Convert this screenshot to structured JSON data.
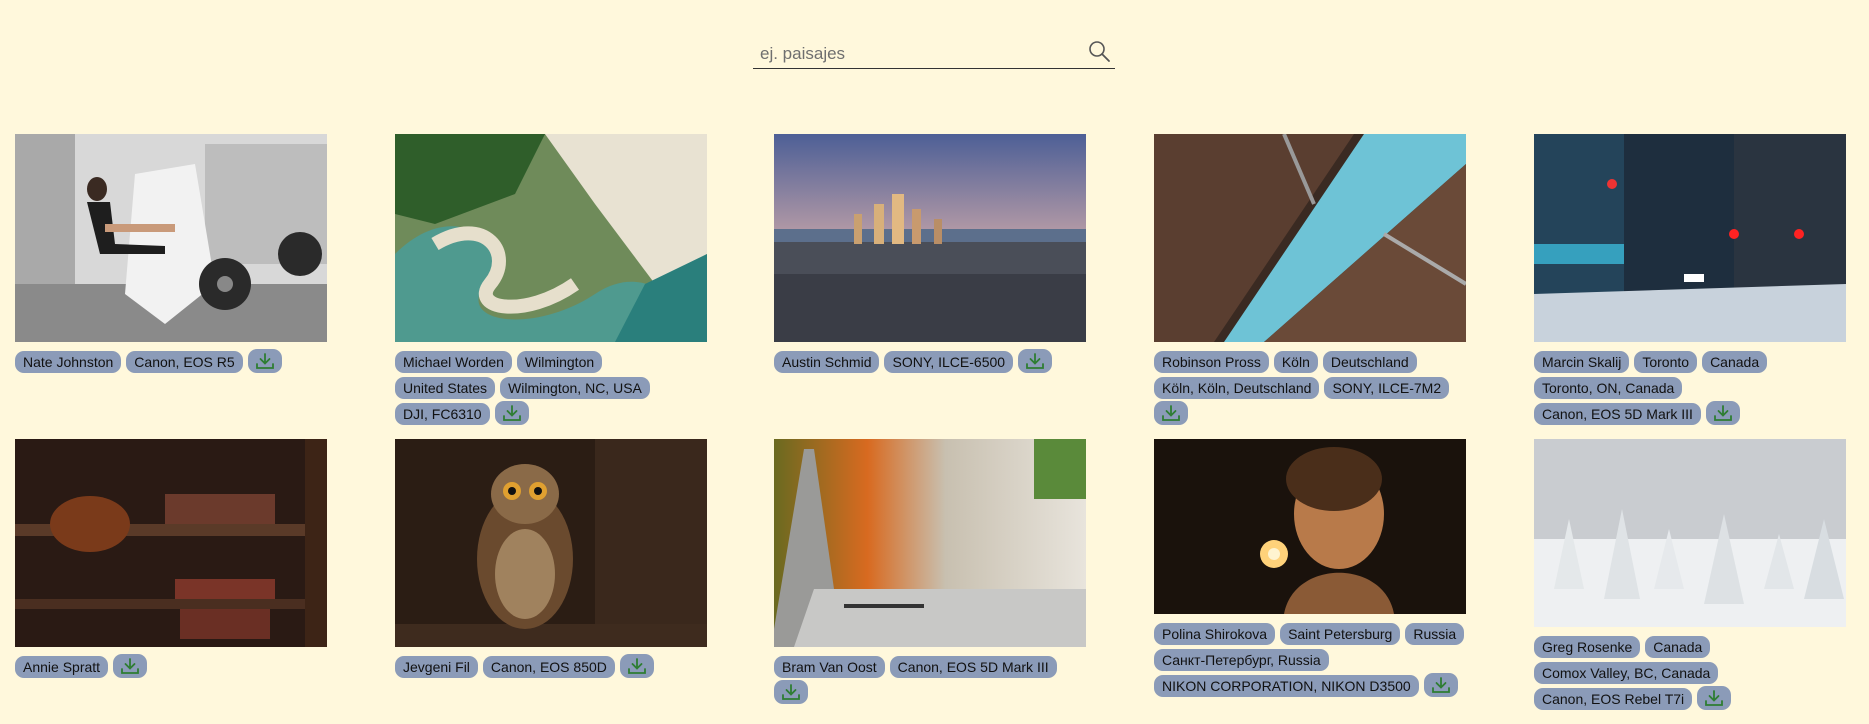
{
  "search": {
    "placeholder": "ej. paisajes",
    "value": ""
  },
  "cards": [
    {
      "tags": [
        "Nate Johnston",
        "Canon, EOS R5"
      ]
    },
    {
      "tags": [
        "Michael Worden",
        "Wilmington",
        "United States",
        "Wilmington, NC, USA",
        "DJI, FC6310"
      ]
    },
    {
      "tags": [
        "Austin Schmid",
        "SONY, ILCE-6500"
      ]
    },
    {
      "tags": [
        "Robinson Pross",
        "Köln",
        "Deutschland",
        "Köln, Köln, Deutschland",
        "SONY, ILCE-7M2"
      ]
    },
    {
      "tags": [
        "Marcin Skalij",
        "Toronto",
        "Canada",
        "Toronto, ON, Canada",
        "Canon, EOS 5D Mark III"
      ]
    },
    {
      "tags": [
        "Annie Spratt"
      ]
    },
    {
      "tags": [
        "Jevgeni Fil",
        "Canon, EOS 850D"
      ]
    },
    {
      "tags": [
        "Bram Van Oost",
        "Canon, EOS 5D Mark III"
      ]
    },
    {
      "tags": [
        "Polina Shirokova",
        "Saint Petersburg",
        "Russia",
        "Санкт-Петербург, Russia",
        "NIKON CORPORATION, NIKON D3500"
      ]
    },
    {
      "tags": [
        "Greg Rosenke",
        "Canada",
        "Comox Valley, BC, Canada",
        "Canon, EOS Rebel T7i"
      ]
    }
  ],
  "icons": {
    "search": "search-icon",
    "download": "download-icon"
  },
  "colors": {
    "background": "#fff8dc",
    "tag": "#8b9bb8",
    "download_arrow": "#2e7d32"
  }
}
